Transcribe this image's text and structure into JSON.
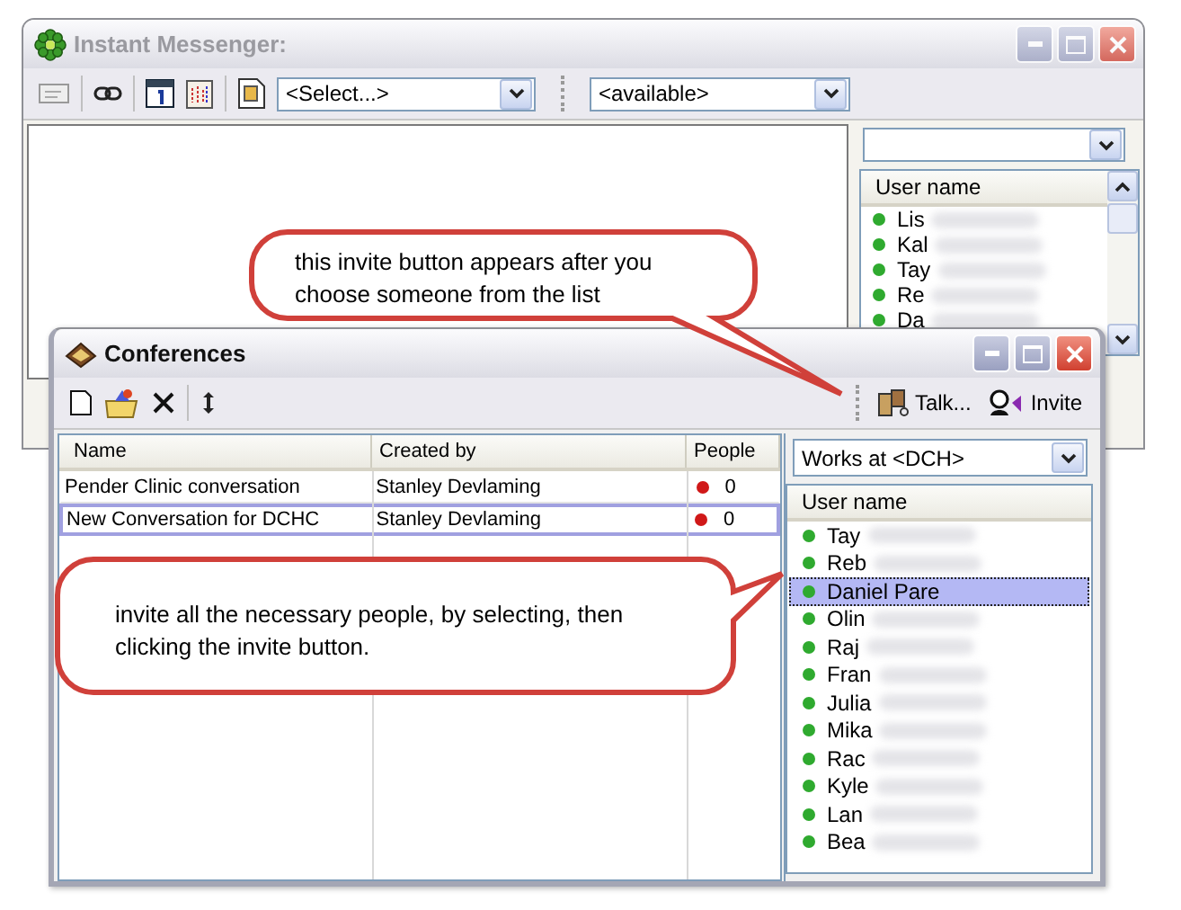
{
  "background_window": {
    "title": "Instant Messenger:",
    "contact_dropdown": {
      "value": "<Select...>"
    },
    "status_dropdown": {
      "value": "<available>"
    },
    "user_list": {
      "column": "User name",
      "rows": [
        {
          "name": "Lis"
        },
        {
          "name": "Kal"
        },
        {
          "name": "Tay"
        },
        {
          "name": "Re"
        },
        {
          "name": "Da"
        }
      ]
    }
  },
  "conferences_window": {
    "title": "Conferences",
    "toolbar": {
      "talk_button": "Talk...",
      "invite_button": "Invite"
    },
    "table": {
      "columns": [
        "Name",
        "Created by",
        "People"
      ],
      "rows": [
        {
          "name": "Pender Clinic conversation",
          "created_by": "Stanley Devlaming",
          "people": "0",
          "selected": false
        },
        {
          "name": "New Conversation for DCHC",
          "created_by": "Stanley Devlaming",
          "people": "0",
          "selected": true
        }
      ]
    },
    "filter_dropdown": {
      "value": "Works at <DCH>"
    },
    "user_list": {
      "column": "User name",
      "rows": [
        {
          "name": "Tay",
          "selected": false
        },
        {
          "name": "Reb",
          "selected": false
        },
        {
          "name": "Daniel Pare",
          "selected": true
        },
        {
          "name": "Olin",
          "selected": false
        },
        {
          "name": "Raj",
          "selected": false
        },
        {
          "name": "Fran",
          "selected": false
        },
        {
          "name": "Julia",
          "selected": false
        },
        {
          "name": "Mika",
          "selected": false
        },
        {
          "name": "Rac",
          "selected": false
        },
        {
          "name": "Kyle",
          "selected": false
        },
        {
          "name": "Lan",
          "selected": false
        },
        {
          "name": "Bea",
          "selected": false
        }
      ]
    }
  },
  "callouts": [
    {
      "text": "this invite button appears after you choose someone from the list"
    },
    {
      "text": "invite all the necessary people, by selecting, then clicking the invite button."
    }
  ]
}
